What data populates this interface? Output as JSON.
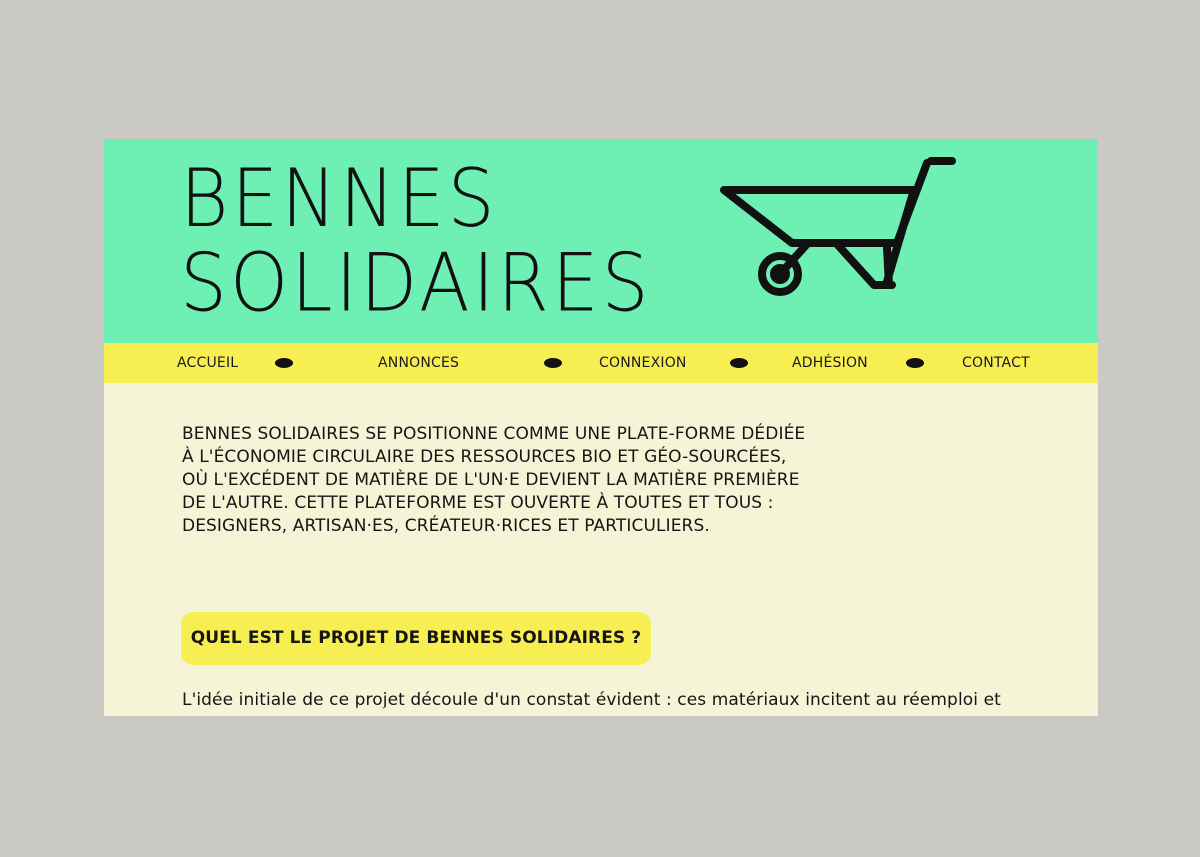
{
  "site": {
    "logo": {
      "line1": "BENNES",
      "line2": "SOLIDAIRES"
    },
    "icons": {
      "header": "wheelbarrow-icon"
    },
    "nav": {
      "items": [
        {
          "label": "ACCUEIL"
        },
        {
          "label": "ANNONCES"
        },
        {
          "label": "CONNEXION"
        },
        {
          "label": "ADHÉSION"
        },
        {
          "label": "CONTACT"
        }
      ]
    },
    "intro": {
      "text": "BENNES SOLIDAIRES SE POSITIONNE COMME UNE PLATE-FORME DÉDIÉE À L'ÉCONOMIE CIRCULAIRE DES RESSOURCES BIO ET GÉO-SOURCÉES, OÙ L'EXCÉDENT DE MATIÈRE DE L'UN·E DEVIENT LA MATIÈRE PREMIÈRE DE L'AUTRE. CETTE PLATEFORME EST OUVERTE À TOUTES ET TOUS : DESIGNERS, ARTISAN·ES, CRÉATEUR·RICES ET PARTICULIERS."
    },
    "project": {
      "button_label": "QUEL EST LE PROJET DE BENNES SOLIDAIRES ?",
      "text": "L'idée initiale de ce projet découle d'un constat évident : ces matériaux incitent au réemploi et"
    },
    "colors": {
      "frame": "#cbc9c4",
      "header": "#6ef0b5",
      "nav": "#f7ee52",
      "content": "#f6f4d6",
      "ink": "#111111"
    }
  }
}
